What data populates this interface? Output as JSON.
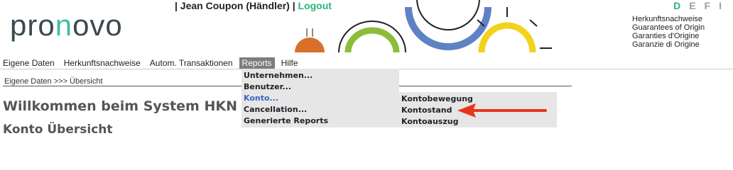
{
  "brand": {
    "logo_prefix": "pro",
    "logo_accent": "n",
    "logo_suffix": "ovo"
  },
  "header": {
    "user_prefix": "| Jean Coupon (Händler) |",
    "logout_label": "Logout",
    "languages": [
      "D",
      "E",
      "F",
      "I"
    ],
    "active_language": "D",
    "tagline": [
      "Herkunftsnachweise",
      "Guarantees of Origin",
      "Garanties d'Origine",
      "Garanzie di Origine"
    ]
  },
  "nav": {
    "items": [
      "Eigene Daten",
      "Herkunftsnachweise",
      "Autom. Transaktionen",
      "Reports",
      "Hilfe"
    ],
    "active": "Reports"
  },
  "breadcrumb": "Eigene Daten >>> Übersicht",
  "main": {
    "welcome_title": "Willkommen beim System HKN Ch",
    "section_title": "Konto Übersicht"
  },
  "reports_menu": {
    "items": [
      "Unternehmen...",
      "Benutzer...",
      "Konto...",
      "Cancellation...",
      "Generierte Reports"
    ],
    "hovered": "Konto..."
  },
  "konto_submenu": {
    "items": [
      "Kontobewegung",
      "Kontostand",
      "Kontoauszug"
    ]
  },
  "colors": {
    "accent_green": "#2bb37a",
    "menu_bg": "#e6e6e6",
    "hover_blue": "#3a64c8",
    "annotation_red": "#e8341c"
  },
  "icons": [
    "sun-rise-icon",
    "arc-green-icon",
    "arc-blue-icon",
    "sun-yellow-icon",
    "arrow-annotation-icon"
  ]
}
